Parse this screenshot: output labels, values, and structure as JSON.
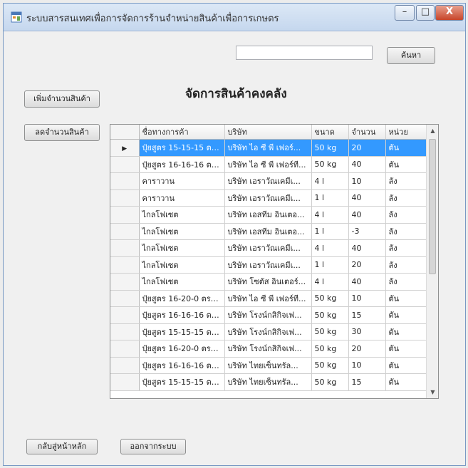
{
  "window": {
    "title": "ระบบสารสนเทศเพื่อการจัดการร้านจำหน่ายสินค้าเพื่อการเกษตร",
    "minimize_glyph": "–",
    "maximize_glyph": "□",
    "close_glyph": "X"
  },
  "search": {
    "value": "",
    "button_label": "ค้นหา"
  },
  "page_title": "จัดการสินค้าคงคลัง",
  "left_buttons": {
    "add_stock": "เพิ่มจำนวนสินค้า",
    "reduce_stock": "ลดจำนวนสินค้า"
  },
  "footer_buttons": {
    "back_main": "กลับสู่หน้าหลัก",
    "logout": "ออกจากระบบ"
  },
  "grid": {
    "columns": [
      "ชื่อทางการค้า",
      "บริษัท",
      "ขนาด",
      "จำนวน",
      "หน่วย"
    ],
    "selected_row_marker": "▶",
    "rows": [
      [
        "ปุ๋ยสูตร 15-15-15 ตร...",
        "บริษัท ไอ ซี พี เฟอร์...",
        "50 kg",
        "20",
        "ตัน"
      ],
      [
        "ปุ๋ยสูตร 16-16-16 ตร...",
        "บริษัท ไอ ซี พี เฟอร์ที...",
        "50 kg",
        "40",
        "ตัน"
      ],
      [
        "คาราวาน",
        "บริษัท เอราวัณเคมีเ...",
        "4 l",
        "10",
        "ลัง"
      ],
      [
        "คาราวาน",
        "บริษัท เอราวัณเคมีเ...",
        "1 l",
        "40",
        "ลัง"
      ],
      [
        "ไกลโฟเซต",
        "บริษัท เอสทีม อินเตอ...",
        "4 l",
        "40",
        "ลัง"
      ],
      [
        "ไกลโฟเซต",
        "บริษัท เอสทีม อินเตอ...",
        "1 l",
        "-3",
        "ลัง"
      ],
      [
        "ไกลโฟเซต",
        "บริษัท เอราวัณเคมีเ...",
        "4 l",
        "40",
        "ลัง"
      ],
      [
        "ไกลโฟเซต",
        "บริษัท เอราวัณเคมีเ...",
        "1 l",
        "20",
        "ลัง"
      ],
      [
        "ไกลโฟเซต",
        "บริษัท โซตัส อินเตอร์...",
        "4 l",
        "40",
        "ลัง"
      ],
      [
        "ปุ๋ยสูตร 16-20-0 ตรา...",
        "บริษัท ไอ ซี พี เฟอร์ที...",
        "50 kg",
        "10",
        "ตัน"
      ],
      [
        "ปุ๋ยสูตร 16-16-16 ตร...",
        "บริษัท โรงน์กสิกิจเฟ...",
        "50 kg",
        "15",
        "ตัน"
      ],
      [
        "ปุ๋ยสูตร 15-15-15 ตร...",
        "บริษัท โรงน์กสิกิจเฟ...",
        "50 kg",
        "30",
        "ตัน"
      ],
      [
        "ปุ๋ยสูตร 16-20-0 ตรา...",
        "บริษัท โรงน์กสิกิจเฟ...",
        "50 kg",
        "20",
        "ตัน"
      ],
      [
        "ปุ๋ยสูตร 16-16-16 ตร...",
        "บริษัท ไทยเซ็นทรัล...",
        "50 kg",
        "10",
        "ตัน"
      ],
      [
        "ปุ๋ยสูตร 15-15-15 ตร...",
        "บริษัท ไทยเซ็นทรัล...",
        "50 kg",
        "15",
        "ตัน"
      ]
    ],
    "selected_row_index": 0
  },
  "icons": {
    "app": "app-window-icon",
    "scroll_up": "scroll-up-arrow-icon",
    "scroll_down": "scroll-down-arrow-icon",
    "row_selector": "row-selector-arrow-icon"
  },
  "colors": {
    "selection": "#3399ff",
    "titlebar": "#c5d7ee",
    "close_button": "#c7452a"
  }
}
